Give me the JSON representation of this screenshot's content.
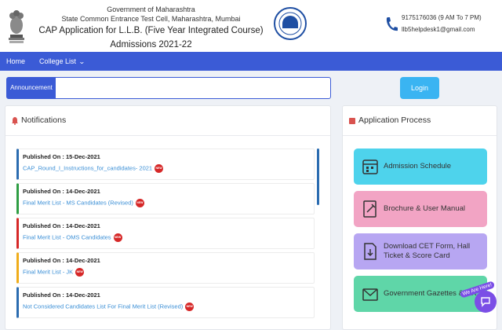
{
  "header": {
    "gov": "Government of Maharashtra",
    "cell": "State Common Entrance Test Cell, Maharashtra, Mumbai",
    "title": "CAP Application for L.L.B. (Five Year Integrated Course) Admissions 2021-22",
    "phone": "9175176036 (9 AM To 7 PM)",
    "email": "llb5helpdesk1@gmail.com"
  },
  "nav": {
    "home": "Home",
    "college": "College List"
  },
  "announcement": {
    "label": "Announcement"
  },
  "login": "Login",
  "notifications": {
    "title": "Notifications",
    "items": [
      {
        "published": "Published On : 15-Dec-2021",
        "text": "CAP_Round_I_Instructions_for_candidates- 2021",
        "color": "#2b6cb0"
      },
      {
        "published": "Published On : 14-Dec-2021",
        "text": "Final Merit List - MS Candidates (Revised)",
        "color": "#2f9e44"
      },
      {
        "published": "Published On : 14-Dec-2021",
        "text": "Final Merit List - OMS Candidates",
        "color": "#d62828"
      },
      {
        "published": "Published On : 14-Dec-2021",
        "text": "Final Merit List - JK",
        "color": "#f0ad1b"
      },
      {
        "published": "Published On : 14-Dec-2021",
        "text": "Not Considered Candidates List For Final Merit List (Revised)",
        "color": "#2b6cb0"
      }
    ],
    "new_badge": "NEW"
  },
  "process": {
    "title": "Application Process",
    "cards": [
      {
        "label": "Admission Schedule",
        "color": "#4ed3ec"
      },
      {
        "label": "Brochure & User Manual",
        "color": "#f2a4c4"
      },
      {
        "label": "Download CET Form, Hall Ticket & Score Card",
        "color": "#b7a6f2"
      },
      {
        "label": "Government Gazettes & GR",
        "color": "#5fd6a8"
      }
    ]
  },
  "chat": {
    "tag": "We Are Here!"
  }
}
